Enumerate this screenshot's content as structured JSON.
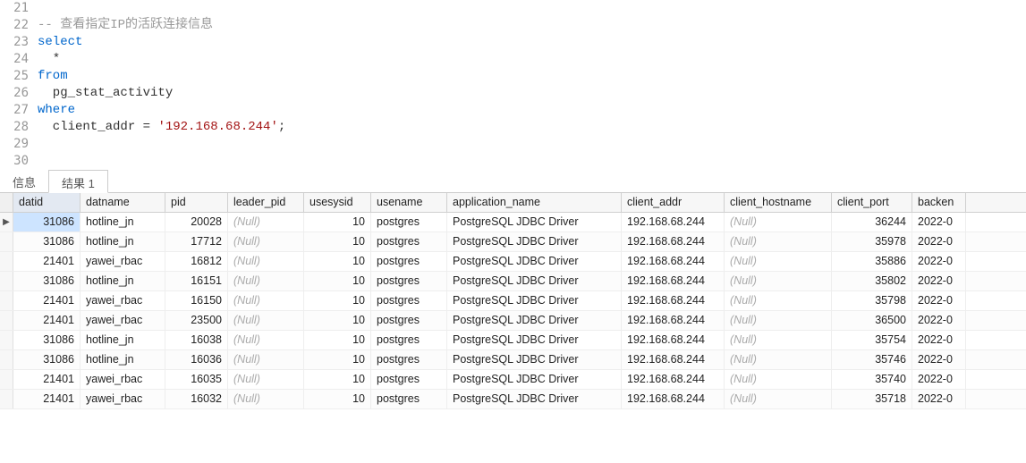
{
  "editor": {
    "lines": [
      {
        "num": "21",
        "tokens": []
      },
      {
        "num": "22",
        "tokens": [
          {
            "t": "-- 查看指定IP的活跃连接信息",
            "c": "cmt"
          }
        ]
      },
      {
        "num": "23",
        "tokens": [
          {
            "t": "select",
            "c": "kw"
          }
        ]
      },
      {
        "num": "24",
        "tokens": [
          {
            "t": "  *",
            "c": "op"
          }
        ]
      },
      {
        "num": "25",
        "tokens": [
          {
            "t": "from",
            "c": "kw"
          }
        ]
      },
      {
        "num": "26",
        "tokens": [
          {
            "t": "  pg_stat_activity",
            "c": ""
          }
        ]
      },
      {
        "num": "27",
        "tokens": [
          {
            "t": "where",
            "c": "kw"
          }
        ]
      },
      {
        "num": "28",
        "tokens": [
          {
            "t": "  client_addr ",
            "c": ""
          },
          {
            "t": "=",
            "c": "op"
          },
          {
            "t": " ",
            "c": ""
          },
          {
            "t": "'192.168.68.244'",
            "c": "str"
          },
          {
            "t": ";",
            "c": "op"
          }
        ]
      },
      {
        "num": "29",
        "tokens": []
      },
      {
        "num": "30",
        "tokens": []
      }
    ]
  },
  "tabs": {
    "info": "信息",
    "result1": "结果 1"
  },
  "nullLabel": "(Null)",
  "columns": {
    "datid": "datid",
    "datname": "datname",
    "pid": "pid",
    "leader_pid": "leader_pid",
    "usesysid": "usesysid",
    "usename": "usename",
    "application_name": "application_name",
    "client_addr": "client_addr",
    "client_hostname": "client_hostname",
    "client_port": "client_port",
    "backend": "backen"
  },
  "rows": [
    {
      "datid": "31086",
      "datname": "hotline_jn",
      "pid": "20028",
      "leader_pid": null,
      "usesysid": "10",
      "usename": "postgres",
      "application_name": "PostgreSQL JDBC Driver",
      "client_addr": "192.168.68.244",
      "client_hostname": null,
      "client_port": "36244",
      "backend": "2022-0",
      "current": true
    },
    {
      "datid": "31086",
      "datname": "hotline_jn",
      "pid": "17712",
      "leader_pid": null,
      "usesysid": "10",
      "usename": "postgres",
      "application_name": "PostgreSQL JDBC Driver",
      "client_addr": "192.168.68.244",
      "client_hostname": null,
      "client_port": "35978",
      "backend": "2022-0"
    },
    {
      "datid": "21401",
      "datname": "yawei_rbac",
      "pid": "16812",
      "leader_pid": null,
      "usesysid": "10",
      "usename": "postgres",
      "application_name": "PostgreSQL JDBC Driver",
      "client_addr": "192.168.68.244",
      "client_hostname": null,
      "client_port": "35886",
      "backend": "2022-0"
    },
    {
      "datid": "31086",
      "datname": "hotline_jn",
      "pid": "16151",
      "leader_pid": null,
      "usesysid": "10",
      "usename": "postgres",
      "application_name": "PostgreSQL JDBC Driver",
      "client_addr": "192.168.68.244",
      "client_hostname": null,
      "client_port": "35802",
      "backend": "2022-0"
    },
    {
      "datid": "21401",
      "datname": "yawei_rbac",
      "pid": "16150",
      "leader_pid": null,
      "usesysid": "10",
      "usename": "postgres",
      "application_name": "PostgreSQL JDBC Driver",
      "client_addr": "192.168.68.244",
      "client_hostname": null,
      "client_port": "35798",
      "backend": "2022-0"
    },
    {
      "datid": "21401",
      "datname": "yawei_rbac",
      "pid": "23500",
      "leader_pid": null,
      "usesysid": "10",
      "usename": "postgres",
      "application_name": "PostgreSQL JDBC Driver",
      "client_addr": "192.168.68.244",
      "client_hostname": null,
      "client_port": "36500",
      "backend": "2022-0"
    },
    {
      "datid": "31086",
      "datname": "hotline_jn",
      "pid": "16038",
      "leader_pid": null,
      "usesysid": "10",
      "usename": "postgres",
      "application_name": "PostgreSQL JDBC Driver",
      "client_addr": "192.168.68.244",
      "client_hostname": null,
      "client_port": "35754",
      "backend": "2022-0"
    },
    {
      "datid": "31086",
      "datname": "hotline_jn",
      "pid": "16036",
      "leader_pid": null,
      "usesysid": "10",
      "usename": "postgres",
      "application_name": "PostgreSQL JDBC Driver",
      "client_addr": "192.168.68.244",
      "client_hostname": null,
      "client_port": "35746",
      "backend": "2022-0"
    },
    {
      "datid": "21401",
      "datname": "yawei_rbac",
      "pid": "16035",
      "leader_pid": null,
      "usesysid": "10",
      "usename": "postgres",
      "application_name": "PostgreSQL JDBC Driver",
      "client_addr": "192.168.68.244",
      "client_hostname": null,
      "client_port": "35740",
      "backend": "2022-0"
    },
    {
      "datid": "21401",
      "datname": "yawei_rbac",
      "pid": "16032",
      "leader_pid": null,
      "usesysid": "10",
      "usename": "postgres",
      "application_name": "PostgreSQL JDBC Driver",
      "client_addr": "192.168.68.244",
      "client_hostname": null,
      "client_port": "35718",
      "backend": "2022-0"
    }
  ]
}
